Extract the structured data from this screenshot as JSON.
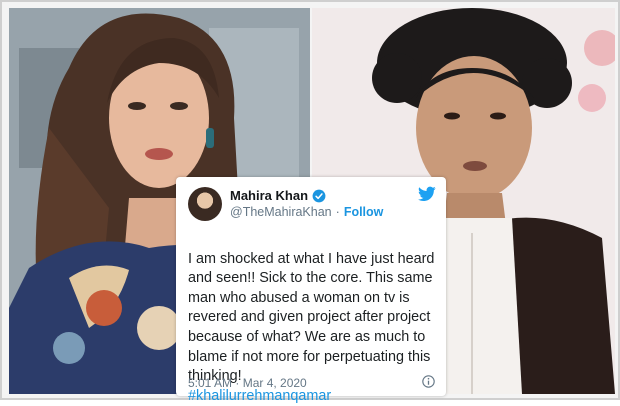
{
  "tweet": {
    "name": "Mahira Khan",
    "handle": "@TheMahiraKhan",
    "separator": "·",
    "follow": "Follow",
    "text": "I am shocked at what I have just heard and seen!! Sick to the core. This same man who abused a woman on tv is revered and given project after project because of what? We are as much to blame if not more for perpetuating this thinking!",
    "hashtag": "#khalilurrehmanqamar",
    "timestamp": "5:01 AM · Mar 4, 2020"
  },
  "icons": {
    "verified": "verified-badge-icon",
    "twitter": "twitter-bird-icon",
    "info": "info-icon"
  },
  "colors": {
    "accent": "#1b95e0",
    "text": "#1c2022",
    "secondary": "#657786"
  }
}
